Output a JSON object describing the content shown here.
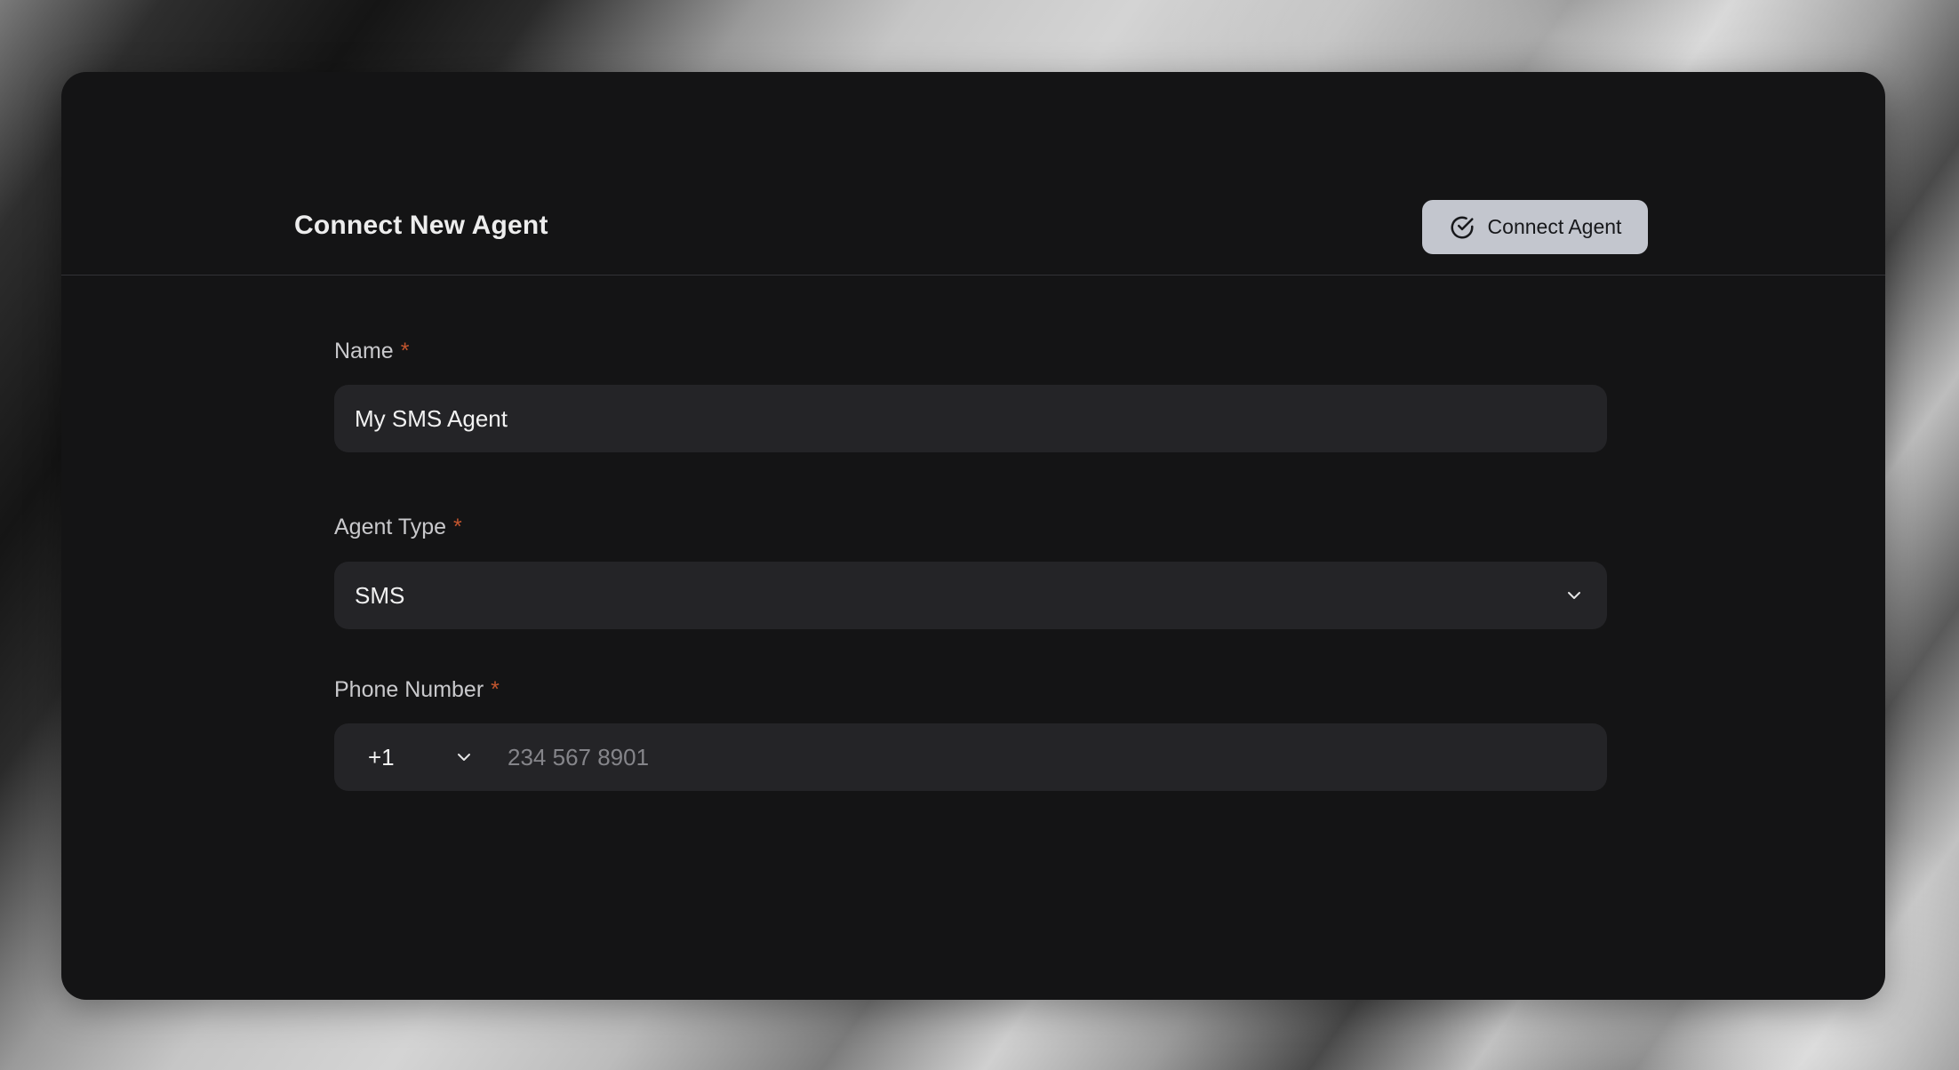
{
  "colors": {
    "card_background": "#141415",
    "field_background": "#242427",
    "button_background": "#c3c6ce",
    "required_marker": "#c2552e"
  },
  "header": {
    "title": "Connect New Agent",
    "connect_button": {
      "label": "Connect Agent",
      "icon": "check-circle-icon"
    }
  },
  "form": {
    "name": {
      "label": "Name",
      "required_marker": "*",
      "value": "My SMS Agent"
    },
    "agent_type": {
      "label": "Agent Type",
      "required_marker": "*",
      "selected": "SMS",
      "icon": "chevron-down-icon"
    },
    "phone_number": {
      "label": "Phone Number",
      "required_marker": "*",
      "country_code": "+1",
      "country_code_icon": "chevron-down-icon",
      "placeholder": "234 567 8901"
    }
  }
}
